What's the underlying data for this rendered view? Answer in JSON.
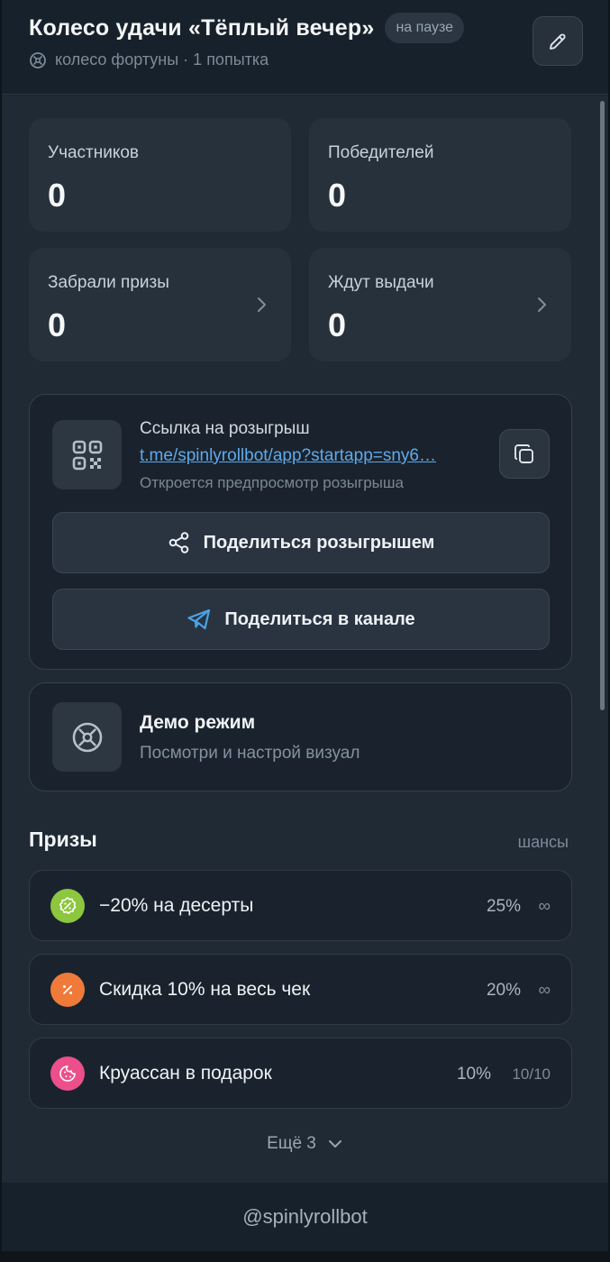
{
  "header": {
    "title": "Колесо удачи «Тёплый вечер»",
    "status_badge": "на паузе",
    "subtitle": "колесо фортуны · 1 попытка",
    "subtitle_icon": "wheel-icon",
    "edit_icon": "pencil-icon"
  },
  "stats": [
    {
      "label": "Участников",
      "value": "0",
      "has_chevron": false
    },
    {
      "label": "Победителей",
      "value": "0",
      "has_chevron": false
    },
    {
      "label": "Забрали призы",
      "value": "0",
      "has_chevron": true
    },
    {
      "label": "Ждут выдачи",
      "value": "0",
      "has_chevron": true
    }
  ],
  "link": {
    "title": "Ссылка на розыгрыш",
    "url": "t.me/spinlyrollbot/app?startapp=sny6…",
    "hint": "Откроется предпросмотр розыгрыша",
    "qr_icon": "qr-code-icon",
    "copy_icon": "copy-icon"
  },
  "actions": {
    "share": "Поделиться розыгрышем",
    "share_channel": "Поделиться в канале"
  },
  "demo": {
    "title": "Демо режим",
    "subtitle": "Посмотри и настрой визуал"
  },
  "prizes": {
    "title": "Призы",
    "right_label": "шансы",
    "items": [
      {
        "name": "−20% на десерты",
        "chance": "25%",
        "limit": "∞",
        "color": "#8dc63f"
      },
      {
        "name": "Скидка 10% на весь чек",
        "chance": "20%",
        "limit": "∞",
        "color": "#f07a3a"
      },
      {
        "name": "Круассан в подарок",
        "chance": "10%",
        "limit": "10/10",
        "color": "#ec4f8a"
      }
    ],
    "more_label": "Ещё 3"
  },
  "footer": {
    "handle": "@spinlyrollbot"
  },
  "colors": {
    "link": "#5fa9ea",
    "telegram": "#4aa3e8"
  }
}
